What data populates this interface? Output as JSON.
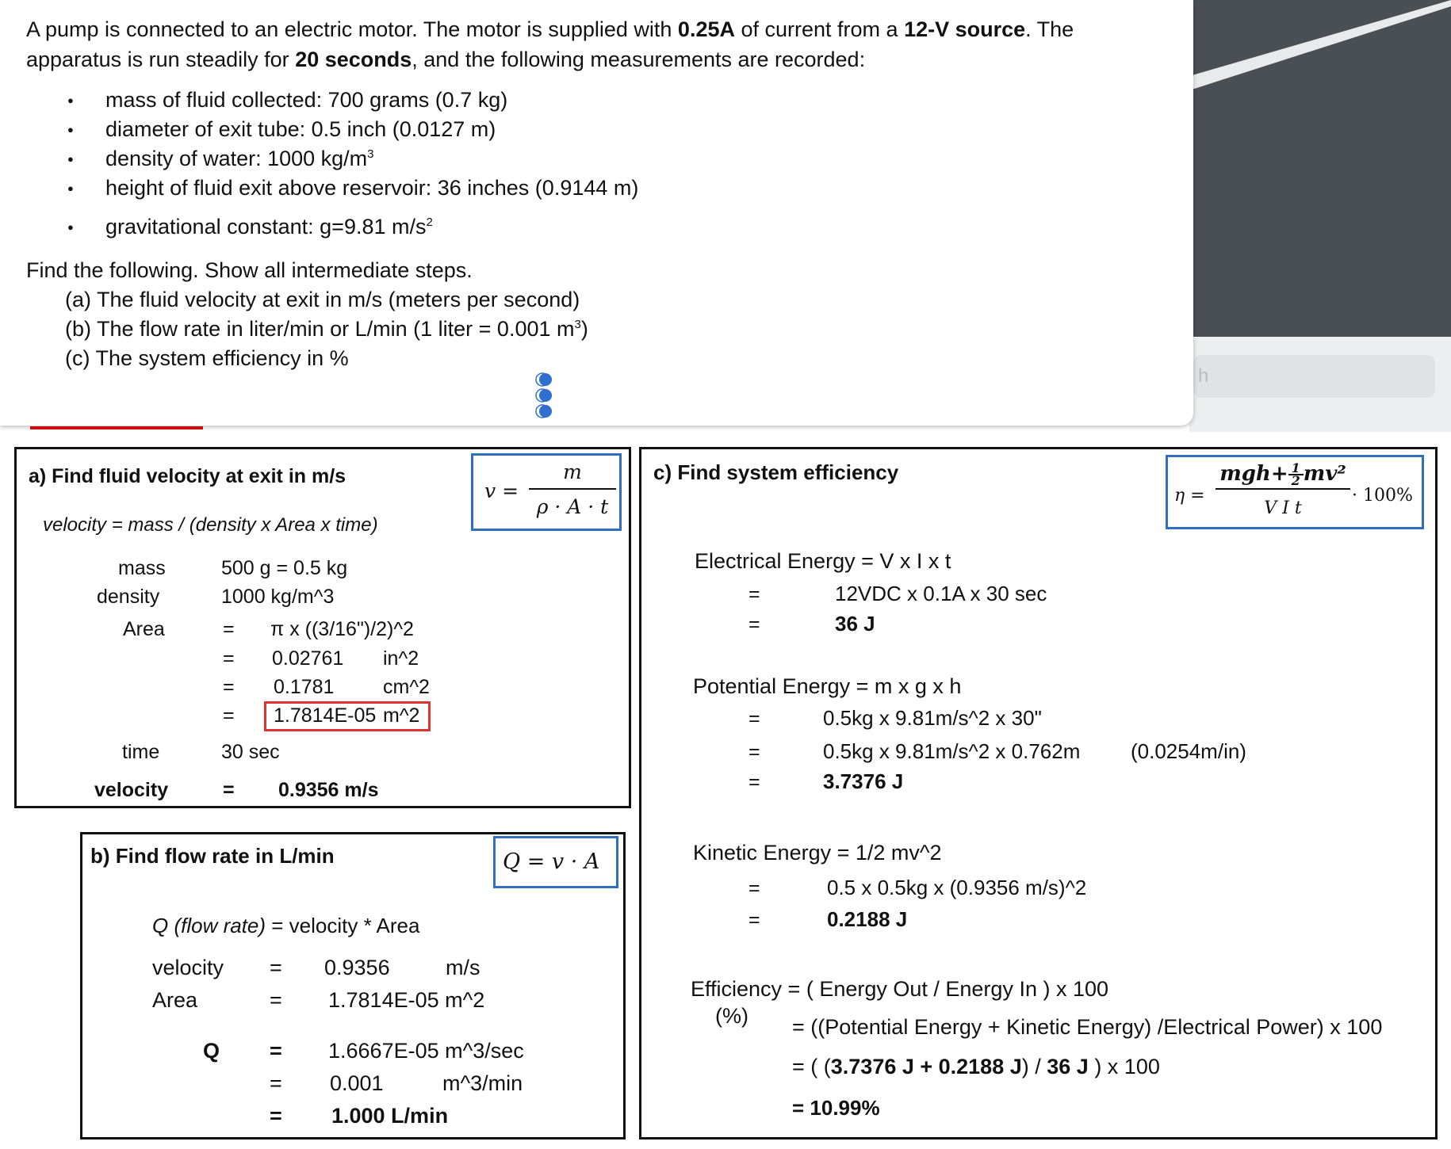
{
  "problem": {
    "intro_1": "A pump is connected to an electric motor. The motor is supplied with ",
    "intro_current": "0.25A",
    "intro_2": " of current from a ",
    "intro_source": "12-V source",
    "intro_3": ". The apparatus is run steadily for ",
    "intro_time": "20 seconds",
    "intro_4": ", and the following measurements are recorded:",
    "bullets": [
      "mass of fluid collected: 700 grams (0.7 kg)",
      "diameter of exit tube: 0.5 inch (0.0127 m)",
      "density of water: 1000 kg/m",
      "height of fluid exit above reservoir: 36 inches (0.9144 m)",
      "gravitational constant: g=9.81 m/s"
    ],
    "sup_3": "3",
    "sup_2": "2",
    "find": "Find the following. Show all intermediate steps.",
    "part_a": "(a) The fluid velocity at exit in m/s (meters per second)",
    "part_b": "(b) The flow rate in liter/min or L/min (1 liter = 0.001 m",
    "part_b_end": ")",
    "part_c": "(c) The system efficiency in %"
  },
  "background": {
    "search_hint": "h"
  },
  "section_a": {
    "heading": "a) Find fluid velocity at exit in m/s",
    "formula_lhs": "v =",
    "formula_num": "m",
    "formula_den": "ρ · A · t",
    "relation": "velocity = mass / (density x Area x time)",
    "mass_label": "mass",
    "mass_value": "500 g   =  0.5 kg",
    "density_label": "density",
    "density_value": "1000 kg/m^3",
    "area_label": "Area",
    "eq": "=",
    "area_expr": "π x ((3/16\")/2)^2",
    "area_in": "0.02761",
    "area_in_unit": "in^2",
    "area_cm": "0.1781",
    "area_cm_unit": "cm^2",
    "area_m": "1.7814E-05",
    "area_m_unit": "m^2",
    "time_label": "time",
    "time_value": "30 sec",
    "velocity_label": "velocity",
    "velocity_value": "0.9356 m/s"
  },
  "section_b": {
    "heading": "b) Find flow rate in L/min",
    "formula": "Q = v · A",
    "relation_label": "Q (flow rate)",
    "relation_rest": " = velocity * Area",
    "velocity_label": "velocity",
    "velocity_value": "0.9356",
    "velocity_unit": "m/s",
    "area_label": "Area",
    "area_value": "1.7814E-05 m^2",
    "q_label": "Q",
    "eq": "=",
    "q1": "1.6667E-05 m^3/sec",
    "q2": "0.001",
    "q2_unit": "m^3/min",
    "q3": "1.000  L/min"
  },
  "section_c": {
    "heading": "c) Find system efficiency",
    "formula_lhs": "η =",
    "formula_num_a": "mgh+",
    "formula_half_num": "1",
    "formula_half_den": "2",
    "formula_num_b": "mv²",
    "formula_den": "V I t",
    "formula_rhs": "· 100%",
    "eq": "=",
    "elec_label": "Electrical Energy  = V  x  I  x  t",
    "elec_1": "12VDC  x  0.1A  x  30 sec",
    "elec_2": "36 J",
    "pe_label": "Potential Energy =  m x g x h",
    "pe_1": "0.5kg  x  9.81m/s^2  x  30\"",
    "pe_2": "0.5kg  x  9.81m/s^2  x  0.762m",
    "pe_2_note": "(0.0254m/in)",
    "pe_3": "3.7376  J",
    "ke_label": "Kinetic Energy = 1/2 mv^2",
    "ke_1": "0.5  x  0.5kg  x  (0.9356  m/s)^2",
    "ke_2": "0.2188  J",
    "eff_label": "Efficiency  =  ( Energy Out / Energy In )  x  100",
    "eff_pct": "(%)",
    "eff_1": "= ((Potential Energy  +  Kinetic Energy) /Electrical Power)  x  100",
    "eff_2_pre": "= ( (",
    "eff_2_bold": "3.7376  J  +  0.2188  J",
    "eff_2_mid": ")  /  ",
    "eff_2_bold2": "36 J",
    "eff_2_post": "  )  x  100",
    "eff_3": "=  10.99%"
  }
}
